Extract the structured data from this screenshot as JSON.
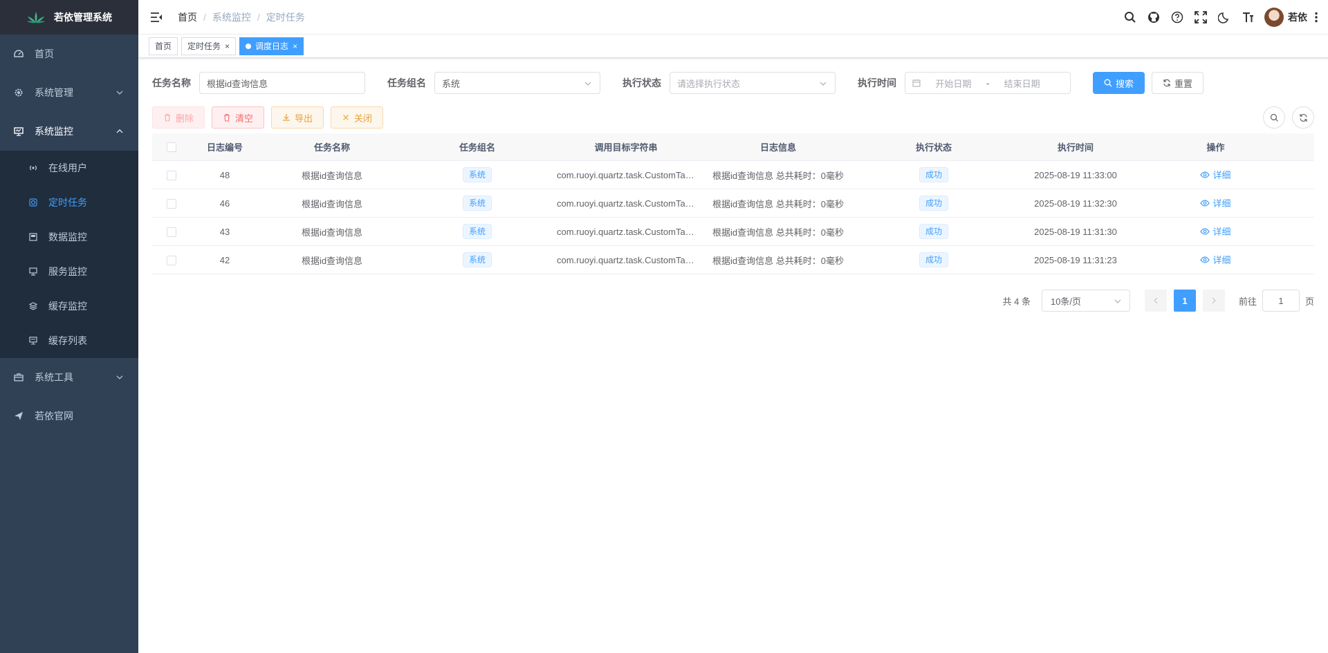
{
  "app": {
    "title": "若依管理系统"
  },
  "sidebar": {
    "items": [
      {
        "label": "首页",
        "icon": "dashboard-icon"
      },
      {
        "label": "系统管理",
        "icon": "gear-icon"
      },
      {
        "label": "系统监控",
        "icon": "monitor-icon",
        "children": [
          {
            "label": "在线用户",
            "icon": "online-icon"
          },
          {
            "label": "定时任务",
            "icon": "job-icon"
          },
          {
            "label": "数据监控",
            "icon": "druid-icon"
          },
          {
            "label": "服务监控",
            "icon": "server-icon"
          },
          {
            "label": "缓存监控",
            "icon": "redis-icon"
          },
          {
            "label": "缓存列表",
            "icon": "redis-list-icon"
          }
        ]
      },
      {
        "label": "系统工具",
        "icon": "tool-icon"
      },
      {
        "label": "若依官网",
        "icon": "guide-icon"
      }
    ]
  },
  "header": {
    "breadcrumb": [
      "首页",
      "系统监控",
      "定时任务"
    ],
    "breadcrumb_sep": "/",
    "username": "若依"
  },
  "tags": [
    {
      "label": "首页"
    },
    {
      "label": "定时任务",
      "close": "×"
    },
    {
      "label": "调度日志",
      "close": "×"
    }
  ],
  "search": {
    "job_name_label": "任务名称",
    "job_name_value": "根据id查询信息",
    "job_group_label": "任务组名",
    "job_group_value": "系统",
    "status_label": "执行状态",
    "status_placeholder": "请选择执行状态",
    "time_label": "执行时间",
    "start_placeholder": "开始日期",
    "range_sep": "-",
    "end_placeholder": "结束日期",
    "search_button": "搜索",
    "reset_button": "重置"
  },
  "toolbar": {
    "delete_label": "删除",
    "clean_label": "清空",
    "export_label": "导出",
    "close_label": "关闭"
  },
  "table": {
    "headers": [
      "日志编号",
      "任务名称",
      "任务组名",
      "调用目标字符串",
      "日志信息",
      "执行状态",
      "执行时间",
      "操作"
    ],
    "rows": [
      {
        "id": "48",
        "name": "根据id查询信息",
        "group": "系统",
        "target": "com.ruoyi.quartz.task.CustomTask.queryById",
        "message": "根据id查询信息 总共耗时：0毫秒",
        "status": "成功",
        "time": "2025-08-19 11:33:00",
        "action": "详细"
      },
      {
        "id": "46",
        "name": "根据id查询信息",
        "group": "系统",
        "target": "com.ruoyi.quartz.task.CustomTask.queryById",
        "message": "根据id查询信息 总共耗时：0毫秒",
        "status": "成功",
        "time": "2025-08-19 11:32:30",
        "action": "详细"
      },
      {
        "id": "43",
        "name": "根据id查询信息",
        "group": "系统",
        "target": "com.ruoyi.quartz.task.CustomTask.queryById",
        "message": "根据id查询信息 总共耗时：0毫秒",
        "status": "成功",
        "time": "2025-08-19 11:31:30",
        "action": "详细"
      },
      {
        "id": "42",
        "name": "根据id查询信息",
        "group": "系统",
        "target": "com.ruoyi.quartz.task.CustomTask.queryById",
        "message": "根据id查询信息 总共耗时：0毫秒",
        "status": "成功",
        "time": "2025-08-19 11:31:23",
        "action": "详细"
      }
    ]
  },
  "pagination": {
    "total": "共 4 条",
    "page_size": "10条/页",
    "current_page": "1",
    "goto_prefix": "前往",
    "goto_value": "1",
    "goto_suffix": "页"
  },
  "colors": {
    "primary": "#409eff",
    "sidebar_bg": "#304156",
    "submenu_bg": "#1f2d3d",
    "danger": "#f56c6c",
    "warning": "#e6a23c"
  }
}
